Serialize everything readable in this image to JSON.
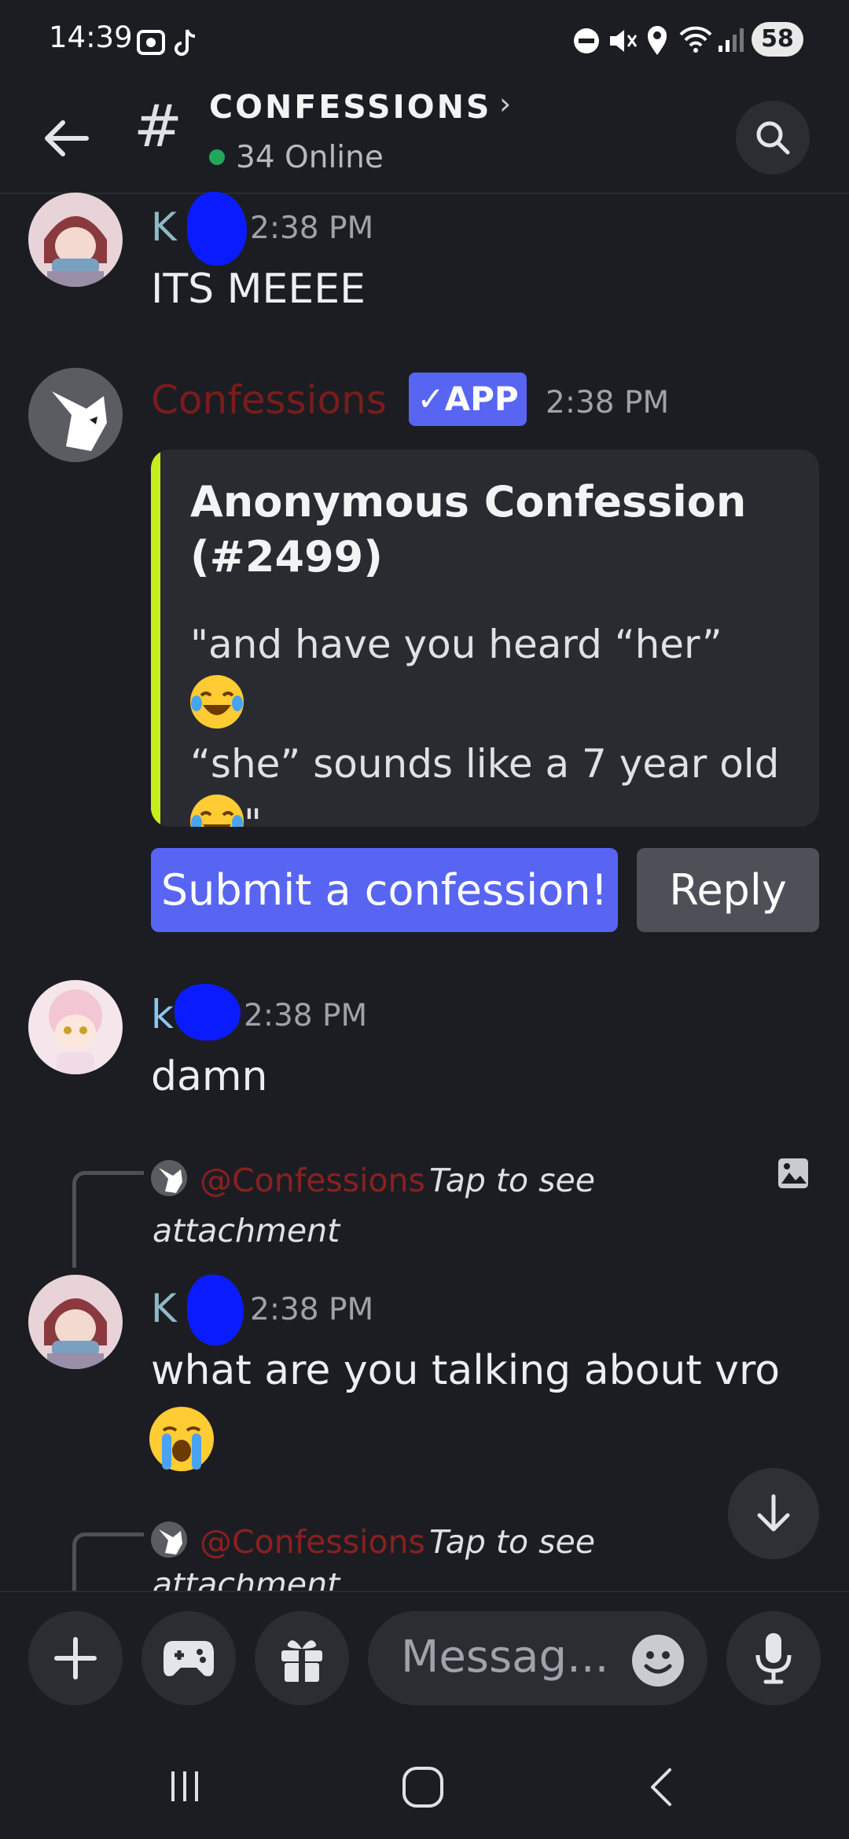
{
  "status_bar": {
    "time": "14:39",
    "battery": "58"
  },
  "header": {
    "channel": "CONFESSIONS",
    "online": "34 Online"
  },
  "messages": [
    {
      "author": "K",
      "time": "2:38 PM",
      "text": "ITS MEEEE",
      "author_color": "#8fb9c4"
    },
    {
      "author": "Confessions",
      "badge": "APP",
      "time": "2:38 PM",
      "author_color": "#7a1c1c"
    },
    {
      "author": "k",
      "time": "2:38 PM",
      "text": "damn",
      "author_color": "#8cc6ee"
    },
    {
      "author": "K",
      "time": "2:38 PM",
      "text": "what are you talking about vro",
      "author_color": "#8fb9c4"
    }
  ],
  "embed": {
    "title": "Anonymous Confession (#2499)",
    "line1": "\"and have you heard “her”",
    "line2": "“she” sounds like a 7 year old",
    "line3_suffix": "\"",
    "accent": "#c6ee1e"
  },
  "buttons": {
    "submit": "Submit a confession!",
    "reply": "Reply"
  },
  "replies": [
    {
      "mention": "@Confessions",
      "text": "Tap to see",
      "text2": "attachment"
    },
    {
      "mention": "@Confessions",
      "text": "Tap to see",
      "text2": "attachment"
    }
  ],
  "composer": {
    "placeholder": "Messag..."
  },
  "icons": [
    "back-arrow-icon",
    "hash-icon",
    "search-icon",
    "image-icon",
    "arrow-down-icon",
    "plus-icon",
    "gamepad-icon",
    "gift-icon",
    "emoji-icon",
    "microphone-icon"
  ]
}
